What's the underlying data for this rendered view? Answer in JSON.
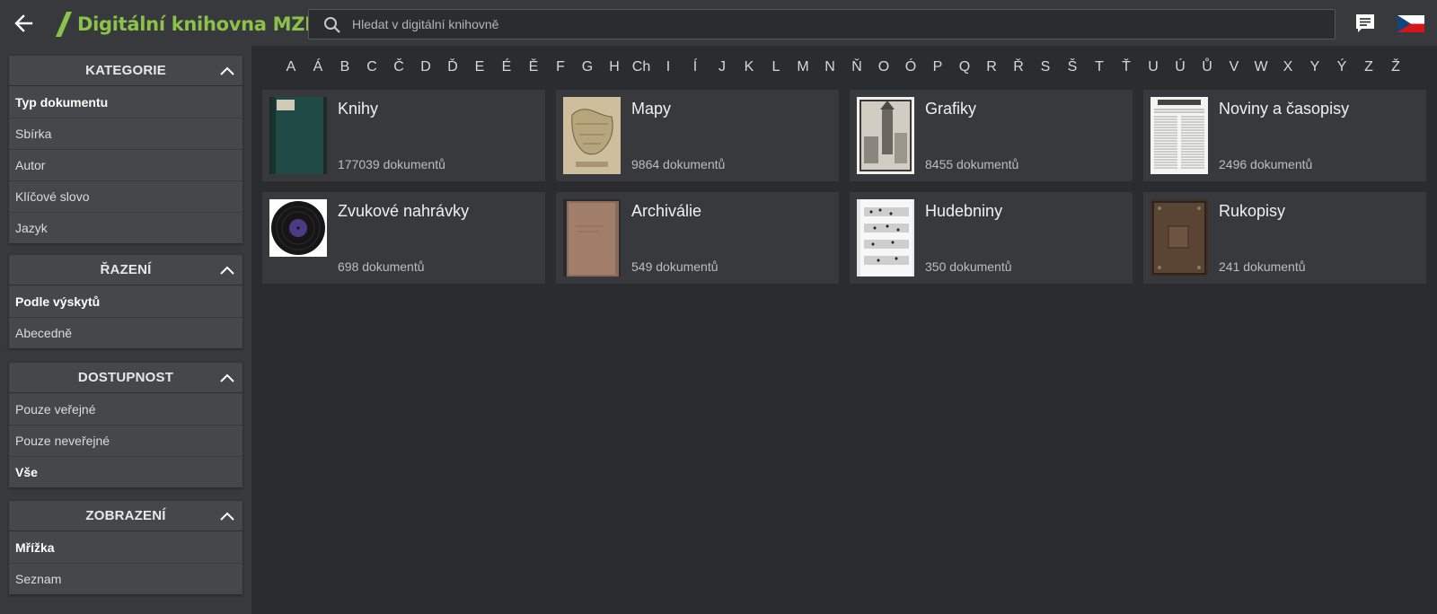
{
  "header": {
    "title": "Digitální knihovna MZK",
    "search_placeholder": "Hledat v digitální knihovně",
    "back_icon": "arrow-left-icon",
    "chat_icon": "chat-icon",
    "language_flag": "czech-flag-icon"
  },
  "colors": {
    "brand_green": "#8bc34a",
    "background": "#2b2c30",
    "panel": "#46474b",
    "card": "#38393d"
  },
  "sidebar": {
    "panels": [
      {
        "title": "KATEGORIE",
        "items": [
          {
            "label": "Typ dokumentu",
            "active": true
          },
          {
            "label": "Sbírka",
            "active": false
          },
          {
            "label": "Autor",
            "active": false
          },
          {
            "label": "Klíčové slovo",
            "active": false
          },
          {
            "label": "Jazyk",
            "active": false
          }
        ]
      },
      {
        "title": "ŘAZENÍ",
        "items": [
          {
            "label": "Podle výskytů",
            "active": true
          },
          {
            "label": "Abecedně",
            "active": false
          }
        ]
      },
      {
        "title": "DOSTUPNOST",
        "items": [
          {
            "label": "Pouze veřejné",
            "active": false
          },
          {
            "label": "Pouze neveřejné",
            "active": false
          },
          {
            "label": "Vše",
            "active": true
          }
        ]
      },
      {
        "title": "ZOBRAZENÍ",
        "items": [
          {
            "label": "Mřížka",
            "active": true
          },
          {
            "label": "Seznam",
            "active": false
          }
        ]
      }
    ]
  },
  "alphabet": [
    "A",
    "Á",
    "B",
    "C",
    "Č",
    "D",
    "Ď",
    "E",
    "É",
    "Ě",
    "F",
    "G",
    "H",
    "Ch",
    "I",
    "Í",
    "J",
    "K",
    "L",
    "M",
    "N",
    "Ň",
    "O",
    "Ó",
    "P",
    "Q",
    "R",
    "Ř",
    "S",
    "Š",
    "T",
    "Ť",
    "U",
    "Ú",
    "Ů",
    "V",
    "W",
    "X",
    "Y",
    "Ý",
    "Z",
    "Ž"
  ],
  "cards": [
    {
      "title": "Knihy",
      "count": "177039 dokumentů",
      "thumb": "book-cover-thumbnail"
    },
    {
      "title": "Mapy",
      "count": "9864 dokumentů",
      "thumb": "map-thumbnail"
    },
    {
      "title": "Grafiky",
      "count": "8455 dokumentů",
      "thumb": "engraving-thumbnail"
    },
    {
      "title": "Noviny a časopisy",
      "count": "2496 dokumentů",
      "thumb": "newspaper-thumbnail"
    },
    {
      "title": "Zvukové nahrávky",
      "count": "698 dokumentů",
      "thumb": "vinyl-record-thumbnail"
    },
    {
      "title": "Archiválie",
      "count": "549 dokumentů",
      "thumb": "archive-folder-thumbnail"
    },
    {
      "title": "Hudebniny",
      "count": "350 dokumentů",
      "thumb": "sheet-music-thumbnail"
    },
    {
      "title": "Rukopisy",
      "count": "241 dokumentů",
      "thumb": "manuscript-thumbnail"
    }
  ]
}
